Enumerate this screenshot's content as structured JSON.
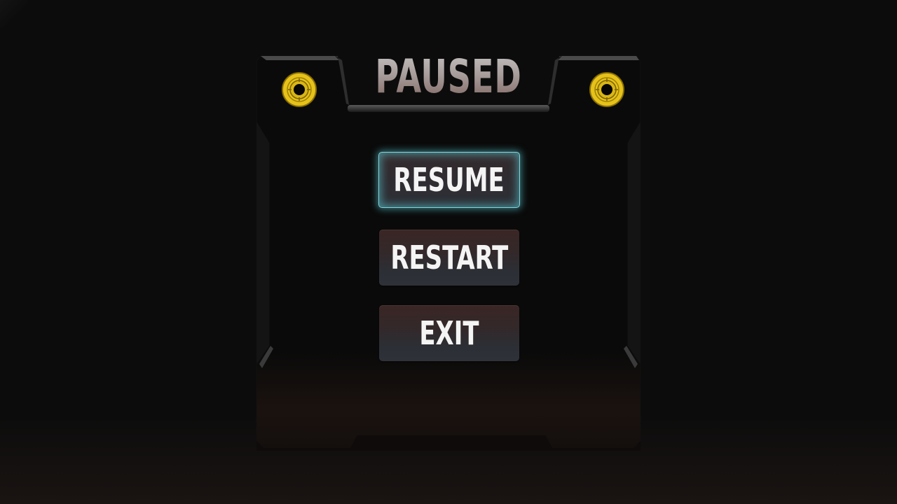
{
  "pause_menu": {
    "title": "PAUSED",
    "buttons": [
      {
        "id": "resume",
        "label": "RESUME",
        "selected": true
      },
      {
        "id": "restart",
        "label": "RESTART",
        "selected": false
      },
      {
        "id": "exit",
        "label": "EXIT",
        "selected": false
      }
    ]
  },
  "colors": {
    "background": "#0c0c0c",
    "panel": "#0a0a0a",
    "panel_bevel": "#3a3a3a",
    "selection_glow": "#5ed2dc",
    "button_top": "#3a2624",
    "button_bottom": "#2e3238",
    "bolt_gold": "#e6c21a",
    "title_top": "#c9c9c9",
    "title_bottom": "#7a5e58"
  },
  "icons": {
    "bolt_left": "gold-bolt-icon",
    "bolt_right": "gold-bolt-icon"
  }
}
